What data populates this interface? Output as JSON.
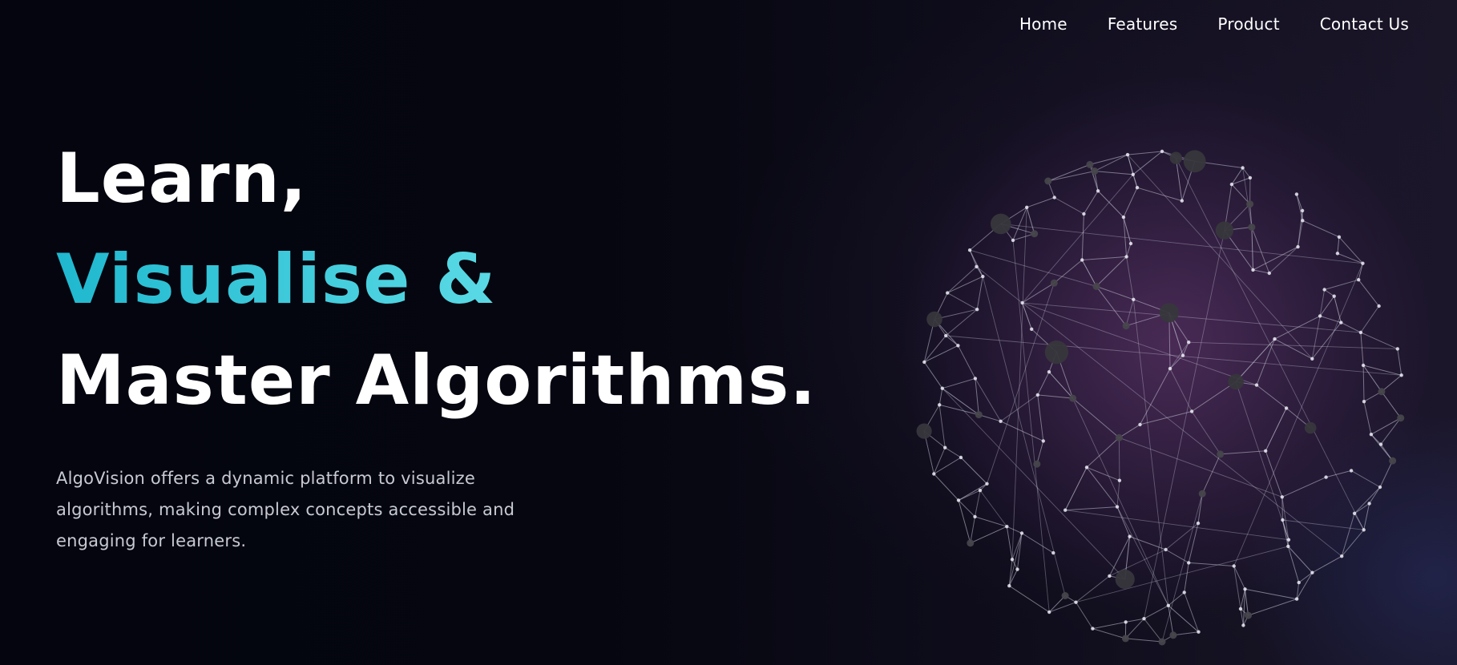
{
  "nav": {
    "items": [
      {
        "label": "Home"
      },
      {
        "label": "Features"
      },
      {
        "label": "Product"
      },
      {
        "label": "Contact Us"
      }
    ]
  },
  "hero": {
    "line1": "Learn,",
    "line2": "Visualise &",
    "line3": "Master Algorithms.",
    "description": "AlgoVision offers a dynamic platform to visualize algorithms, making complex concepts accessible and engaging for learners."
  },
  "colors": {
    "background": "#04050f",
    "accent_start": "#1fb8cf",
    "accent_end": "#9fe9ee",
    "text": "#ffffff",
    "muted_text": "#c7c9d3",
    "glow": "#6e3c78"
  },
  "graphic": {
    "icon": "network-sphere-icon"
  }
}
